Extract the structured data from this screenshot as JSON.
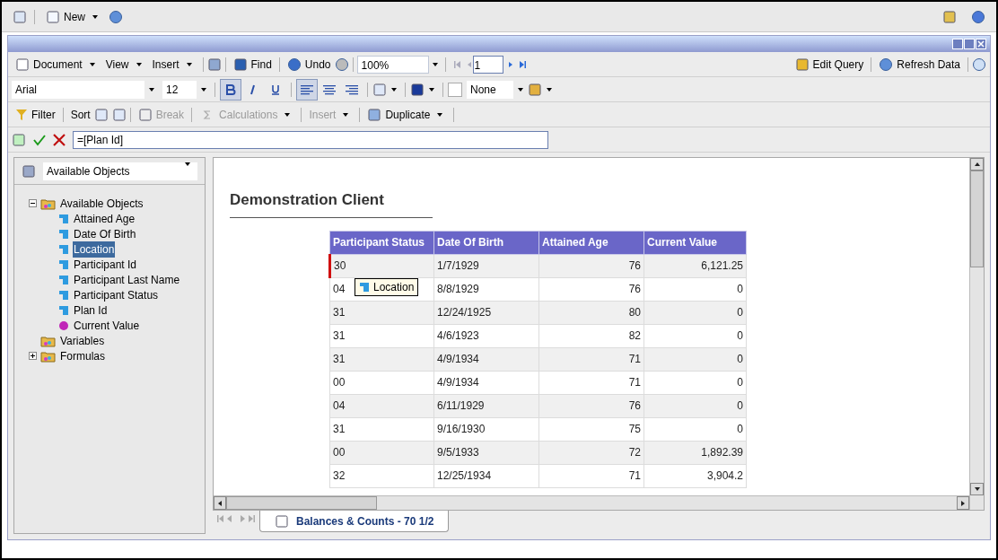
{
  "top_bar": {
    "new_label": "New"
  },
  "toolbar1": {
    "document": "Document",
    "view": "View",
    "insert": "Insert",
    "find": "Find",
    "undo": "Undo",
    "zoom": "100%",
    "page": "1",
    "edit_query": "Edit Query",
    "refresh": "Refresh Data"
  },
  "toolbar2": {
    "font": "Arial",
    "size": "12",
    "bold": true,
    "italic": false,
    "underline": false,
    "alignment": [
      {
        "selected": true
      },
      {
        "selected": false
      },
      {
        "selected": false
      }
    ],
    "border": "None"
  },
  "toolbar3": {
    "filter": "Filter",
    "sort": "Sort",
    "break": "Break",
    "calculations": "Calculations",
    "insert": "Insert",
    "duplicate": "Duplicate"
  },
  "formula": {
    "value": "=[Plan Id]"
  },
  "sidebar": {
    "selector": "Available Objects",
    "tree": [
      {
        "label": "Available Objects",
        "kind": "folder",
        "expanded": true,
        "children": [
          {
            "label": "Attained Age",
            "kind": "dimension",
            "selected": false
          },
          {
            "label": "Date Of Birth",
            "kind": "dimension",
            "selected": false
          },
          {
            "label": "Location",
            "kind": "dimension",
            "selected": true
          },
          {
            "label": "Participant Id",
            "kind": "dimension",
            "selected": false
          },
          {
            "label": "Participant Last Name",
            "kind": "dimension",
            "selected": false
          },
          {
            "label": "Participant Status",
            "kind": "dimension",
            "selected": false
          },
          {
            "label": "Plan Id",
            "kind": "dimension",
            "selected": false
          },
          {
            "label": "Current Value",
            "kind": "measure",
            "selected": false
          }
        ]
      },
      {
        "label": "Variables",
        "kind": "folder"
      },
      {
        "label": "Formulas",
        "kind": "folder",
        "expanded": false
      }
    ]
  },
  "report": {
    "title": "Demonstration Client",
    "drag_tooltip": "Location",
    "table": {
      "columns": [
        "Participant Status",
        "Date Of Birth",
        "Attained Age",
        "Current Value"
      ],
      "rows": [
        {
          "selected": true,
          "cells": [
            "30",
            "1/7/1929",
            "76",
            "6,121.25"
          ]
        },
        {
          "selected": false,
          "cells": [
            "04",
            "8/8/1929",
            "76",
            "0"
          ]
        },
        {
          "selected": false,
          "cells": [
            "31",
            "12/24/1925",
            "80",
            "0"
          ]
        },
        {
          "selected": false,
          "cells": [
            "31",
            "4/6/1923",
            "82",
            "0"
          ]
        },
        {
          "selected": false,
          "cells": [
            "31",
            "4/9/1934",
            "71",
            "0"
          ]
        },
        {
          "selected": false,
          "cells": [
            "00",
            "4/9/1934",
            "71",
            "0"
          ]
        },
        {
          "selected": false,
          "cells": [
            "04",
            "6/11/1929",
            "76",
            "0"
          ]
        },
        {
          "selected": false,
          "cells": [
            "31",
            "9/16/1930",
            "75",
            "0"
          ]
        },
        {
          "selected": false,
          "cells": [
            "00",
            "9/5/1933",
            "72",
            "1,892.39"
          ]
        },
        {
          "selected": false,
          "cells": [
            "32",
            "12/25/1934",
            "71",
            "3,904.2"
          ]
        }
      ]
    }
  },
  "tabs": [
    {
      "label": "Balances & Counts - 70 1/2",
      "selected": true
    }
  ]
}
